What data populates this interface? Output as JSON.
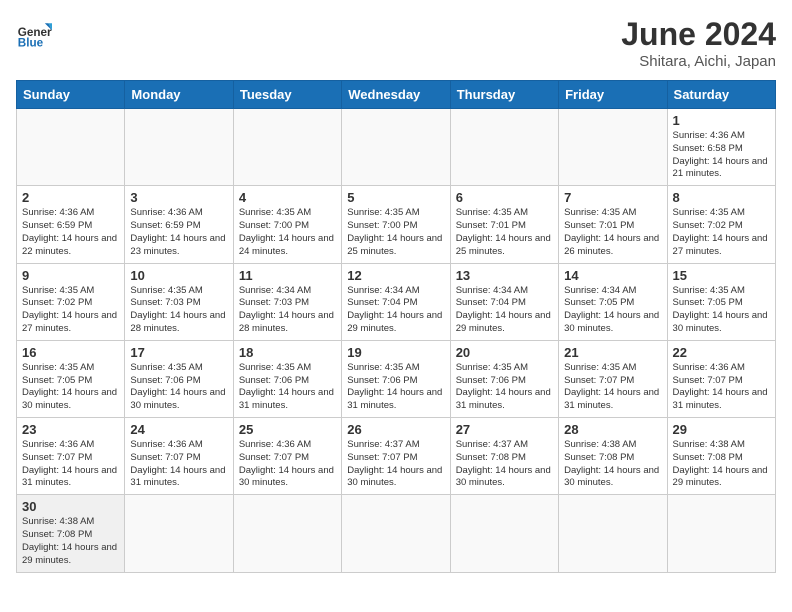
{
  "header": {
    "logo_general": "General",
    "logo_blue": "Blue",
    "month_title": "June 2024",
    "subtitle": "Shitara, Aichi, Japan"
  },
  "weekdays": [
    "Sunday",
    "Monday",
    "Tuesday",
    "Wednesday",
    "Thursday",
    "Friday",
    "Saturday"
  ],
  "weeks": [
    [
      {
        "day": "",
        "info": ""
      },
      {
        "day": "",
        "info": ""
      },
      {
        "day": "",
        "info": ""
      },
      {
        "day": "",
        "info": ""
      },
      {
        "day": "",
        "info": ""
      },
      {
        "day": "",
        "info": ""
      },
      {
        "day": "1",
        "info": "Sunrise: 4:36 AM\nSunset: 6:58 PM\nDaylight: 14 hours\nand 21 minutes."
      }
    ],
    [
      {
        "day": "2",
        "info": "Sunrise: 4:36 AM\nSunset: 6:59 PM\nDaylight: 14 hours\nand 22 minutes."
      },
      {
        "day": "3",
        "info": "Sunrise: 4:36 AM\nSunset: 6:59 PM\nDaylight: 14 hours\nand 23 minutes."
      },
      {
        "day": "4",
        "info": "Sunrise: 4:35 AM\nSunset: 7:00 PM\nDaylight: 14 hours\nand 24 minutes."
      },
      {
        "day": "5",
        "info": "Sunrise: 4:35 AM\nSunset: 7:00 PM\nDaylight: 14 hours\nand 25 minutes."
      },
      {
        "day": "6",
        "info": "Sunrise: 4:35 AM\nSunset: 7:01 PM\nDaylight: 14 hours\nand 25 minutes."
      },
      {
        "day": "7",
        "info": "Sunrise: 4:35 AM\nSunset: 7:01 PM\nDaylight: 14 hours\nand 26 minutes."
      },
      {
        "day": "8",
        "info": "Sunrise: 4:35 AM\nSunset: 7:02 PM\nDaylight: 14 hours\nand 27 minutes."
      }
    ],
    [
      {
        "day": "9",
        "info": "Sunrise: 4:35 AM\nSunset: 7:02 PM\nDaylight: 14 hours\nand 27 minutes."
      },
      {
        "day": "10",
        "info": "Sunrise: 4:35 AM\nSunset: 7:03 PM\nDaylight: 14 hours\nand 28 minutes."
      },
      {
        "day": "11",
        "info": "Sunrise: 4:34 AM\nSunset: 7:03 PM\nDaylight: 14 hours\nand 28 minutes."
      },
      {
        "day": "12",
        "info": "Sunrise: 4:34 AM\nSunset: 7:04 PM\nDaylight: 14 hours\nand 29 minutes."
      },
      {
        "day": "13",
        "info": "Sunrise: 4:34 AM\nSunset: 7:04 PM\nDaylight: 14 hours\nand 29 minutes."
      },
      {
        "day": "14",
        "info": "Sunrise: 4:34 AM\nSunset: 7:05 PM\nDaylight: 14 hours\nand 30 minutes."
      },
      {
        "day": "15",
        "info": "Sunrise: 4:35 AM\nSunset: 7:05 PM\nDaylight: 14 hours\nand 30 minutes."
      }
    ],
    [
      {
        "day": "16",
        "info": "Sunrise: 4:35 AM\nSunset: 7:05 PM\nDaylight: 14 hours\nand 30 minutes."
      },
      {
        "day": "17",
        "info": "Sunrise: 4:35 AM\nSunset: 7:06 PM\nDaylight: 14 hours\nand 30 minutes."
      },
      {
        "day": "18",
        "info": "Sunrise: 4:35 AM\nSunset: 7:06 PM\nDaylight: 14 hours\nand 31 minutes."
      },
      {
        "day": "19",
        "info": "Sunrise: 4:35 AM\nSunset: 7:06 PM\nDaylight: 14 hours\nand 31 minutes."
      },
      {
        "day": "20",
        "info": "Sunrise: 4:35 AM\nSunset: 7:06 PM\nDaylight: 14 hours\nand 31 minutes."
      },
      {
        "day": "21",
        "info": "Sunrise: 4:35 AM\nSunset: 7:07 PM\nDaylight: 14 hours\nand 31 minutes."
      },
      {
        "day": "22",
        "info": "Sunrise: 4:36 AM\nSunset: 7:07 PM\nDaylight: 14 hours\nand 31 minutes."
      }
    ],
    [
      {
        "day": "23",
        "info": "Sunrise: 4:36 AM\nSunset: 7:07 PM\nDaylight: 14 hours\nand 31 minutes."
      },
      {
        "day": "24",
        "info": "Sunrise: 4:36 AM\nSunset: 7:07 PM\nDaylight: 14 hours\nand 31 minutes."
      },
      {
        "day": "25",
        "info": "Sunrise: 4:36 AM\nSunset: 7:07 PM\nDaylight: 14 hours\nand 30 minutes."
      },
      {
        "day": "26",
        "info": "Sunrise: 4:37 AM\nSunset: 7:07 PM\nDaylight: 14 hours\nand 30 minutes."
      },
      {
        "day": "27",
        "info": "Sunrise: 4:37 AM\nSunset: 7:08 PM\nDaylight: 14 hours\nand 30 minutes."
      },
      {
        "day": "28",
        "info": "Sunrise: 4:38 AM\nSunset: 7:08 PM\nDaylight: 14 hours\nand 30 minutes."
      },
      {
        "day": "29",
        "info": "Sunrise: 4:38 AM\nSunset: 7:08 PM\nDaylight: 14 hours\nand 29 minutes."
      }
    ],
    [
      {
        "day": "30",
        "info": "Sunrise: 4:38 AM\nSunset: 7:08 PM\nDaylight: 14 hours\nand 29 minutes."
      },
      {
        "day": "",
        "info": ""
      },
      {
        "day": "",
        "info": ""
      },
      {
        "day": "",
        "info": ""
      },
      {
        "day": "",
        "info": ""
      },
      {
        "day": "",
        "info": ""
      },
      {
        "day": "",
        "info": ""
      }
    ]
  ]
}
